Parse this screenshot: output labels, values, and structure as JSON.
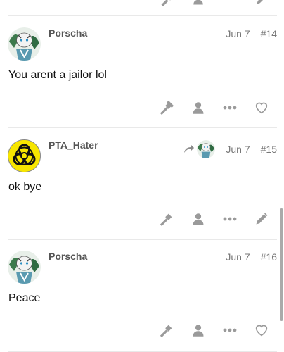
{
  "posts": [
    {
      "username": "Porscha",
      "date": "Jun 7",
      "number": "#14",
      "text": "You arent a jailor lol",
      "avatar_icon": "tiger-warrior-avatar-icon",
      "actions": [
        "hammer-icon",
        "user-icon",
        "more-icon",
        "heart-icon"
      ]
    },
    {
      "username": "PTA_Hater",
      "date": "Jun 7",
      "number": "#15",
      "text": "ok bye",
      "avatar_icon": "biohazard-avatar-icon",
      "reply_to_icon": "reply-arrow-icon",
      "actions": [
        "hammer-icon",
        "user-icon",
        "more-icon",
        "pencil-icon"
      ]
    },
    {
      "username": "Porscha",
      "date": "Jun 7",
      "number": "#16",
      "text": "Peace",
      "avatar_icon": "tiger-warrior-avatar-icon",
      "actions": [
        "hammer-icon",
        "user-icon",
        "more-icon",
        "heart-icon"
      ]
    }
  ],
  "colors": {
    "icon": "#9a9a9a",
    "divider": "#e9e9e9",
    "biohazard_yellow": "#f7e600"
  }
}
